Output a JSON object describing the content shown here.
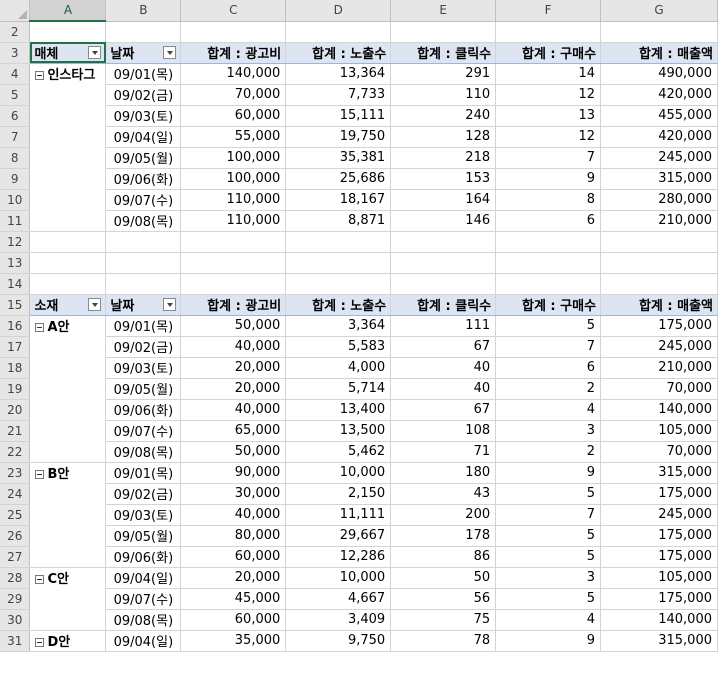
{
  "columns": [
    "A",
    "B",
    "C",
    "D",
    "E",
    "F",
    "G"
  ],
  "row_numbers": [
    "2",
    "3",
    "4",
    "5",
    "6",
    "7",
    "8",
    "9",
    "10",
    "11",
    "12",
    "13",
    "14",
    "15",
    "16",
    "17",
    "18",
    "19",
    "20",
    "21",
    "22",
    "23",
    "24",
    "25",
    "26",
    "27",
    "28",
    "29",
    "30",
    "31"
  ],
  "pivot1": {
    "header": {
      "field": "매체",
      "date": "날짜",
      "cost": "합계 : 광고비",
      "impr": "합계 : 노출수",
      "clicks": "합계 : 클릭수",
      "purch": "합계 : 구매수",
      "rev": "합계 : 매출액"
    },
    "groups": [
      {
        "name": "인스타그",
        "rows": [
          {
            "date": "09/01(목)",
            "cost": "140,000",
            "impr": "13,364",
            "clicks": "291",
            "purch": "14",
            "rev": "490,000"
          },
          {
            "date": "09/02(금)",
            "cost": "70,000",
            "impr": "7,733",
            "clicks": "110",
            "purch": "12",
            "rev": "420,000"
          },
          {
            "date": "09/03(토)",
            "cost": "60,000",
            "impr": "15,111",
            "clicks": "240",
            "purch": "13",
            "rev": "455,000"
          },
          {
            "date": "09/04(일)",
            "cost": "55,000",
            "impr": "19,750",
            "clicks": "128",
            "purch": "12",
            "rev": "420,000"
          },
          {
            "date": "09/05(월)",
            "cost": "100,000",
            "impr": "35,381",
            "clicks": "218",
            "purch": "7",
            "rev": "245,000"
          },
          {
            "date": "09/06(화)",
            "cost": "100,000",
            "impr": "25,686",
            "clicks": "153",
            "purch": "9",
            "rev": "315,000"
          },
          {
            "date": "09/07(수)",
            "cost": "110,000",
            "impr": "18,167",
            "clicks": "164",
            "purch": "8",
            "rev": "280,000"
          },
          {
            "date": "09/08(목)",
            "cost": "110,000",
            "impr": "8,871",
            "clicks": "146",
            "purch": "6",
            "rev": "210,000"
          }
        ]
      }
    ]
  },
  "pivot2": {
    "header": {
      "field": "소재",
      "date": "날짜",
      "cost": "합계 : 광고비",
      "impr": "합계 : 노출수",
      "clicks": "합계 : 클릭수",
      "purch": "합계 : 구매수",
      "rev": "합계 : 매출액"
    },
    "groups": [
      {
        "name": "A안",
        "rows": [
          {
            "date": "09/01(목)",
            "cost": "50,000",
            "impr": "3,364",
            "clicks": "111",
            "purch": "5",
            "rev": "175,000"
          },
          {
            "date": "09/02(금)",
            "cost": "40,000",
            "impr": "5,583",
            "clicks": "67",
            "purch": "7",
            "rev": "245,000"
          },
          {
            "date": "09/03(토)",
            "cost": "20,000",
            "impr": "4,000",
            "clicks": "40",
            "purch": "6",
            "rev": "210,000"
          },
          {
            "date": "09/05(월)",
            "cost": "20,000",
            "impr": "5,714",
            "clicks": "40",
            "purch": "2",
            "rev": "70,000"
          },
          {
            "date": "09/06(화)",
            "cost": "40,000",
            "impr": "13,400",
            "clicks": "67",
            "purch": "4",
            "rev": "140,000"
          },
          {
            "date": "09/07(수)",
            "cost": "65,000",
            "impr": "13,500",
            "clicks": "108",
            "purch": "3",
            "rev": "105,000"
          },
          {
            "date": "09/08(목)",
            "cost": "50,000",
            "impr": "5,462",
            "clicks": "71",
            "purch": "2",
            "rev": "70,000"
          }
        ]
      },
      {
        "name": "B안",
        "rows": [
          {
            "date": "09/01(목)",
            "cost": "90,000",
            "impr": "10,000",
            "clicks": "180",
            "purch": "9",
            "rev": "315,000"
          },
          {
            "date": "09/02(금)",
            "cost": "30,000",
            "impr": "2,150",
            "clicks": "43",
            "purch": "5",
            "rev": "175,000"
          },
          {
            "date": "09/03(토)",
            "cost": "40,000",
            "impr": "11,111",
            "clicks": "200",
            "purch": "7",
            "rev": "245,000"
          },
          {
            "date": "09/05(월)",
            "cost": "80,000",
            "impr": "29,667",
            "clicks": "178",
            "purch": "5",
            "rev": "175,000"
          },
          {
            "date": "09/06(화)",
            "cost": "60,000",
            "impr": "12,286",
            "clicks": "86",
            "purch": "5",
            "rev": "175,000"
          }
        ]
      },
      {
        "name": "C안",
        "rows": [
          {
            "date": "09/04(일)",
            "cost": "20,000",
            "impr": "10,000",
            "clicks": "50",
            "purch": "3",
            "rev": "105,000"
          },
          {
            "date": "09/07(수)",
            "cost": "45,000",
            "impr": "4,667",
            "clicks": "56",
            "purch": "5",
            "rev": "175,000"
          },
          {
            "date": "09/08(목)",
            "cost": "60,000",
            "impr": "3,409",
            "clicks": "75",
            "purch": "4",
            "rev": "140,000"
          }
        ]
      },
      {
        "name": "D안",
        "rows": [
          {
            "date": "09/04(일)",
            "cost": "35,000",
            "impr": "9,750",
            "clicks": "78",
            "purch": "9",
            "rev": "315,000"
          }
        ]
      }
    ]
  }
}
